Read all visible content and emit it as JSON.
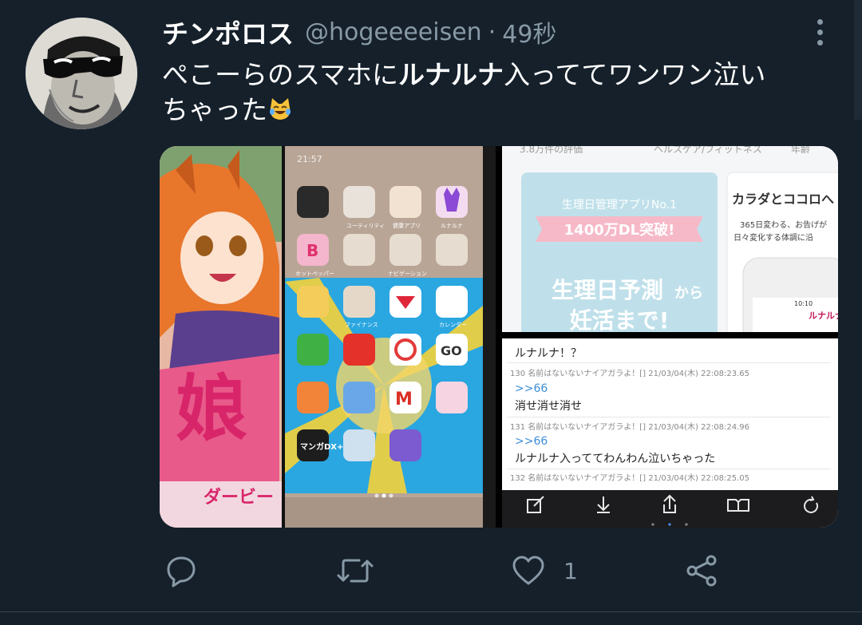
{
  "tweet": {
    "display_name": "チンポロス",
    "handle": "@hogeeeeisen",
    "separator": "·",
    "time": "49秒",
    "text_line1_prefix": "ぺこーらのスマホに",
    "text_line1_bold": "ルナルナ",
    "text_line1_suffix": "入っててワンワン泣い",
    "text_line2": "ちゃった",
    "emoji_icon": "joy-cat-icon"
  },
  "media": {
    "left_image": {
      "status_time": "21:57",
      "banner_text": "ダービー",
      "app_labels": [
        "ユーティリティ",
        "健康アプリ",
        "ルナルナ",
        "ホットペッパー",
        "ナビゲーション",
        "ファイナンス",
        "カレンダー",
        "マンガDX+"
      ]
    },
    "top_right_image": {
      "top_text": "3.8万件の評価",
      "category": "ヘルスケア/フィットネス",
      "age": "年齢",
      "headline1": "生理日管理アプリNo.1",
      "headline2": "1400万DL突破!",
      "headline3": "生理日予測",
      "headline3_suffix": "から",
      "headline4": "妊活まで!",
      "side_title": "カラダとココロへ",
      "side_line1": "365日変わる、お告げが",
      "side_line2": "日々変化する体調に沿",
      "side_app_name": "ルナルナ",
      "side_time": "10:10"
    },
    "bottom_right_image": {
      "posts": [
        {
          "body": "ルナルナ！？"
        },
        {
          "meta": "130 名前はないないナイアガラよ！[] 21/03/04(木) 22:08:23.65",
          "link": ">>66",
          "body": "消せ消せ消せ"
        },
        {
          "meta": "131 名前はないないナイアガラよ！[] 21/03/04(木) 22:08:24.96",
          "link": ">>66",
          "body": "ルナルナ入っててわんわん泣いちゃった"
        },
        {
          "meta": "132 名前はないないナイアガラよ！[] 21/03/04(木) 22:08:25.05"
        }
      ]
    }
  },
  "actions": {
    "reply_icon": "reply-icon",
    "retweet_icon": "retweet-icon",
    "like_icon": "heart-icon",
    "like_count": "1",
    "share_icon": "share-icon"
  },
  "colors": {
    "background": "#15202b",
    "secondary_text": "#8899a6",
    "divider": "#38444d"
  }
}
